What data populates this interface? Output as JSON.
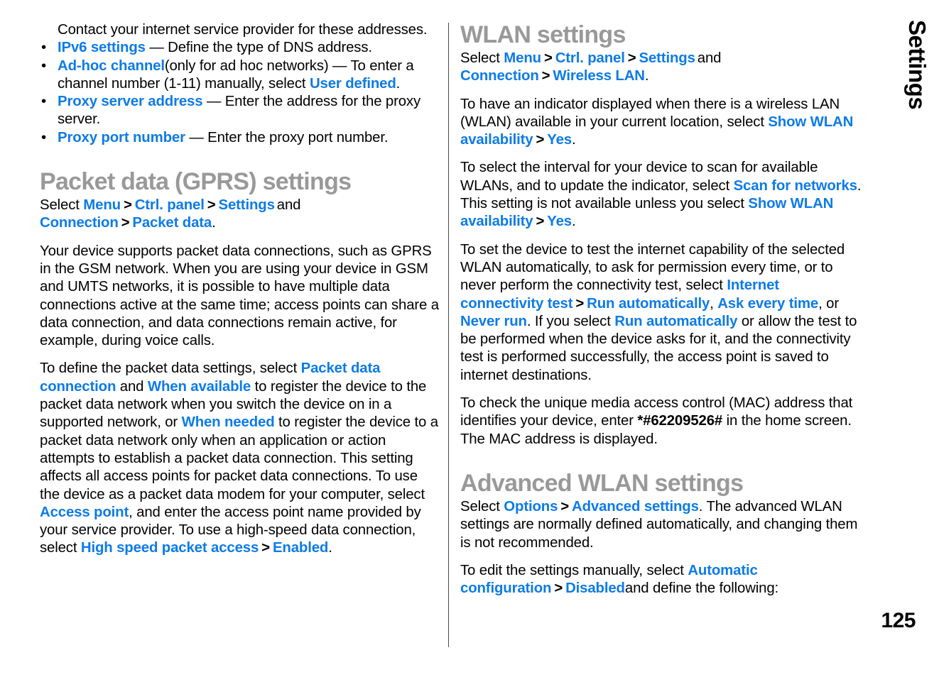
{
  "page": {
    "number": "125",
    "side_tab_label": "Settings",
    "chevron": ">"
  },
  "left_column": {
    "intro_paragraph": "Contact your internet service provider for these addresses.",
    "bullets": [
      {
        "term": "IPv6 settings",
        "rest": " — Define the type of DNS address."
      },
      {
        "term": "Ad-hoc channel",
        "rest": "(only for ad hoc networks) — To enter a channel number (1-11) manually, select ",
        "term2": "User defined",
        "rest2": "."
      },
      {
        "term": "Proxy server address",
        "rest": " — Enter the address for the proxy server."
      },
      {
        "term": "Proxy port number",
        "rest": " — Enter the proxy port number."
      }
    ],
    "section": {
      "heading": "Packet data (GPRS) settings",
      "select_line": {
        "lead": "Select ",
        "item1": "Menu",
        "item2": "Ctrl. panel",
        "item3": "Settings",
        "conjunction": "and ",
        "item4": "Connection",
        "item5": "Packet data",
        "trailing": "."
      },
      "paragraph1": "Your device supports packet data connections, such as GPRS in the GSM network. When you are using your device in GSM and UMTS networks, it is possible to have multiple data connections active at the same time; access points can share a data connection, and data connections remain active, for example, during voice calls.",
      "paragraph2": {
        "t1": "To define the packet data settings, select ",
        "ui1": "Packet data connection",
        "t2": " and ",
        "ui2": "When available",
        "t3": " to register the device to the packet data network when you switch the device on in a supported network, or ",
        "ui3": "When needed",
        "t4": " to register the device to a packet data network only when an application or action attempts to establish a packet data connection. This setting affects all access points for packet data connections. To use the device as a packet data modem for your computer, select ",
        "ui4": "Access point",
        "t5": ", and enter the access point name provided by your service provider. To use a high-speed data connection, select ",
        "ui5": "High speed packet access",
        "ui6": "Enabled",
        "t6": "."
      }
    }
  },
  "right_column": {
    "section_wlan": {
      "heading": "WLAN settings",
      "select_line": {
        "lead": "Select ",
        "item1": "Menu",
        "item2": "Ctrl. panel",
        "item3": "Settings",
        "conjunction": "and ",
        "item4": "Connection",
        "item5": "Wireless LAN",
        "trailing": "."
      },
      "paragraph_indicator": {
        "t1": "To have an indicator displayed when there is a wireless LAN (WLAN) available in your current location, select ",
        "ui1": "Show WLAN availability",
        "ui2": "Yes",
        "t2": "."
      },
      "paragraph_scan": {
        "t1": "To select the interval for your device to scan for available WLANs, and to update the indicator, select ",
        "ui1": "Scan for networks",
        "t2": ". This setting is not available unless you select ",
        "ui2": "Show WLAN availability",
        "ui3": "Yes",
        "t3": "."
      },
      "paragraph_connectivity": {
        "t1": "To set the device to test the internet capability of the selected WLAN automatically, to ask for permission every time, or to never perform the connectivity test, select ",
        "ui1": "Internet connectivity test",
        "ui2": "Run automatically",
        "t2": ", ",
        "ui3": "Ask every time",
        "t3": ", or ",
        "ui4": "Never run",
        "t4": ". If you select ",
        "ui5": "Run automatically",
        "t5": " or allow the test to be performed when the device asks for it, and the connectivity test is performed successfully, the access point is saved to internet destinations."
      },
      "paragraph_mac": {
        "t1": "To check the unique media access control (MAC) address that identifies your device, enter ",
        "code": "*#62209526#",
        "t2": " in the home screen. The MAC address is displayed."
      }
    },
    "section_advanced": {
      "heading": "Advanced WLAN settings",
      "paragraph_options": {
        "lead": "Select ",
        "ui1": "Options",
        "ui2": "Advanced settings",
        "t1": ". The advanced WLAN settings are normally defined automatically, and changing them is not recommended."
      },
      "paragraph_manual": {
        "t1": "To edit the settings manually, select ",
        "ui1": "Automatic configuration",
        "ui2": "Disabled",
        "t2": "and define the following:"
      }
    }
  },
  "colors": {
    "ui_term_blue": "#0d7be8",
    "heading_gray": "#999999",
    "body_black": "#000000",
    "divider_gray": "#4a4a4a"
  }
}
